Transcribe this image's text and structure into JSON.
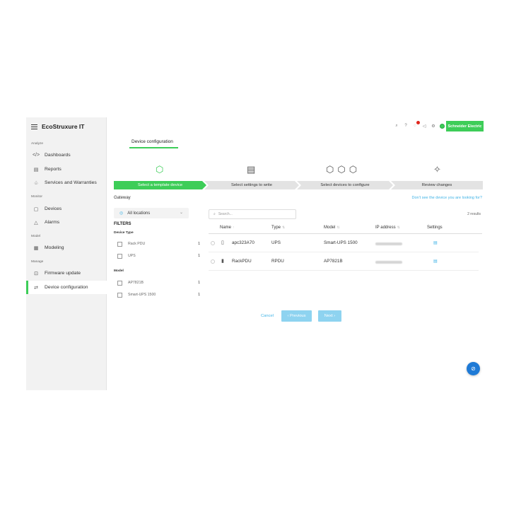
{
  "brand": {
    "product": "EcoStruxure IT",
    "company_logo": "Schneider Electric",
    "accent": "#3dcd58",
    "link": "#42b4e6"
  },
  "sidebar": {
    "sections": {
      "analyze": "Analyze",
      "monitor": "Monitor",
      "model": "Model",
      "manage": "Manage"
    },
    "items": [
      {
        "label": "Dashboards",
        "icon": "dashboard-icon"
      },
      {
        "label": "Reports",
        "icon": "report-icon"
      },
      {
        "label": "Services and Warranties",
        "icon": "services-icon"
      },
      {
        "label": "Devices",
        "icon": "devices-icon"
      },
      {
        "label": "Alarms",
        "icon": "alarm-icon"
      },
      {
        "label": "Modeling",
        "icon": "modeling-icon"
      },
      {
        "label": "Firmware update",
        "icon": "firmware-icon"
      },
      {
        "label": "Device configuration",
        "icon": "device-config-icon",
        "active": true
      }
    ]
  },
  "topbar": {
    "icons": [
      "search-icon",
      "help-icon",
      "notifications-icon",
      "megaphone-icon",
      "settings-icon",
      "status-icon"
    ]
  },
  "page_tab": "Device configuration",
  "steps": [
    {
      "label": "Select a template device",
      "active": true,
      "icon": "template-device-icon"
    },
    {
      "label": "Select settings to write",
      "active": false,
      "icon": "settings-doc-icon"
    },
    {
      "label": "Select devices to configure",
      "active": false,
      "icon": "multi-device-icon"
    },
    {
      "label": "Review changes",
      "active": false,
      "icon": "magic-wand-icon"
    }
  ],
  "gateway": {
    "label": "Gateway",
    "selected": "All locations"
  },
  "help_link": "Don't see the device you are looking for?",
  "filters": {
    "title": "FILTERS",
    "device_type": {
      "label": "Device Type",
      "options": [
        {
          "label": "Rack PDU",
          "count": "1"
        },
        {
          "label": "UPS",
          "count": "1"
        }
      ]
    },
    "model": {
      "label": "Model",
      "options": [
        {
          "label": "AP7821B",
          "count": "1"
        },
        {
          "label": "Smart-UPS 1500",
          "count": "1"
        }
      ]
    }
  },
  "search": {
    "placeholder": "Search..."
  },
  "results": "2 results",
  "table": {
    "headers": {
      "name": "Name",
      "type": "Type",
      "model": "Model",
      "ip": "IP address",
      "settings": "Settings"
    },
    "rows": [
      {
        "name": "apc323A70",
        "type": "UPS",
        "model": "Smart-UPS 1500"
      },
      {
        "name": "RackPDU",
        "type": "RPDU",
        "model": "AP7821B"
      }
    ]
  },
  "buttons": {
    "cancel": "Cancel",
    "previous": "Previous",
    "next": "Next"
  }
}
